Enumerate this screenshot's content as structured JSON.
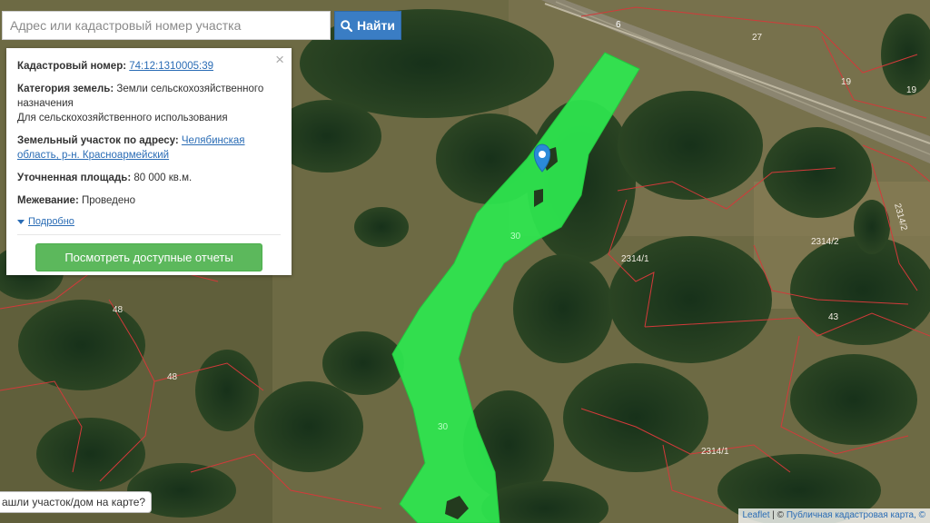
{
  "search": {
    "placeholder": "Адрес или кадастровый номер участка",
    "button_label": "Найти",
    "button_icon": "search-icon"
  },
  "info_panel": {
    "close_glyph": "×",
    "cadastral_number_label": "Кадастровый номер:",
    "cadastral_number_value": "74:12:1310005:39",
    "category_label": "Категория земель:",
    "category_value_1": "Земли сельскохозяйственного назначения",
    "category_value_2": "Для сельскохозяйственного использования",
    "address_label": "Земельный участок по адресу:",
    "address_value": "Челябинская область, р-н. Красноармейский",
    "area_label": "Уточненная площадь:",
    "area_value": "80 000 кв.м.",
    "survey_label": "Межевание:",
    "survey_value": "Проведено",
    "more_link": "Подробно",
    "reports_button": "Посмотреть доступные отчеты"
  },
  "map": {
    "parcel_label": "30",
    "road_label": "6",
    "plot_labels": [
      "27",
      "19",
      "19",
      "2314/2",
      "2314/2",
      "2314/1",
      "43",
      "48",
      "48",
      "2314/1"
    ],
    "selection_color": "#2ee84f",
    "boundary_color": "#d23a3a",
    "marker_color": "#2a8ad8"
  },
  "footer": {
    "question_button": "ашли участок/дом на карте?",
    "attribution_leaflet": "Leaflet",
    "attribution_separator": " | © ",
    "attribution_source": "Публичная кадастровая карта, ©"
  }
}
